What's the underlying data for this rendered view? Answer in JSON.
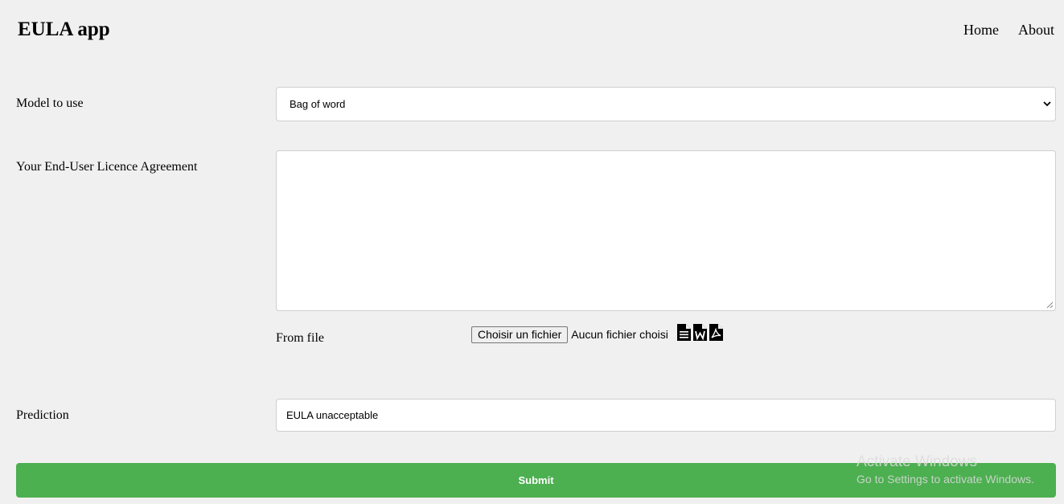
{
  "header": {
    "title": "EULA app",
    "nav": [
      {
        "label": "Home"
      },
      {
        "label": "About"
      }
    ]
  },
  "form": {
    "model": {
      "label": "Model to use",
      "selected": "Bag of word"
    },
    "eula": {
      "label": "Your End-User Licence Agreement",
      "value": ""
    },
    "file": {
      "label": "From file",
      "button_label": "Choisir un fichier",
      "status": "Aucun fichier choisi",
      "icons": [
        "text-file-icon",
        "word-file-icon",
        "pdf-file-icon"
      ]
    },
    "prediction": {
      "label": "Prediction",
      "value": "EULA unacceptable"
    },
    "submit_label": "Submit"
  },
  "watermark": {
    "title": "Activate Windows",
    "subtitle": "Go to Settings to activate Windows."
  },
  "colors": {
    "background": "#f0f0f0",
    "submit": "#4caf50"
  }
}
